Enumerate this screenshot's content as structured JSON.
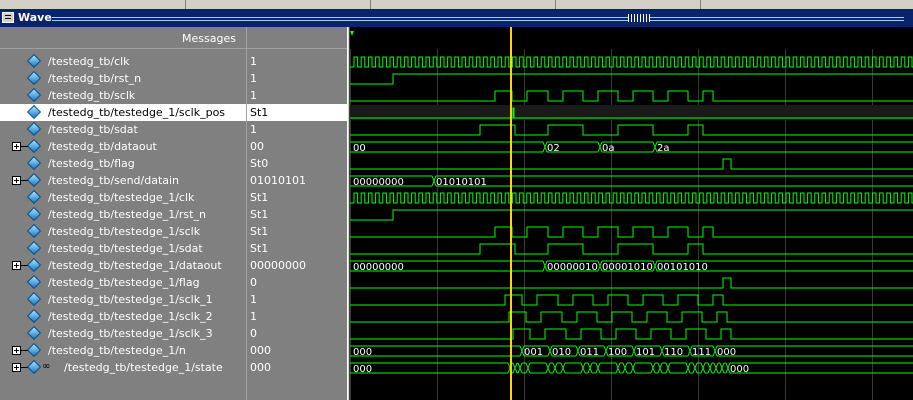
{
  "window": {
    "title": "Wave"
  },
  "columns": {
    "messages": "Messages"
  },
  "colors": {
    "wave": "#00ff00",
    "cursor": "#ffd700",
    "grid": "#3a3a3a",
    "background": "#000000"
  },
  "signals": [
    {
      "name": "/testedg_tb/clk",
      "value": "1",
      "type": "bit",
      "expandable": false
    },
    {
      "name": "/testedg_tb/rst_n",
      "value": "1",
      "type": "bit",
      "expandable": false
    },
    {
      "name": "/testedg_tb/sclk",
      "value": "1",
      "type": "bit",
      "expandable": false
    },
    {
      "name": "/testedg_tb/testedge_1/sclk_pos",
      "value": "St1",
      "type": "bit",
      "expandable": false,
      "selected": true
    },
    {
      "name": "/testedg_tb/sdat",
      "value": "1",
      "type": "bit",
      "expandable": false
    },
    {
      "name": "/testedg_tb/dataout",
      "value": "00",
      "type": "bus",
      "expandable": true
    },
    {
      "name": "/testedg_tb/flag",
      "value": "St0",
      "type": "bit",
      "expandable": false
    },
    {
      "name": "/testedg_tb/send/datain",
      "value": "01010101",
      "type": "bus",
      "expandable": true
    },
    {
      "name": "/testedg_tb/testedge_1/clk",
      "value": "St1",
      "type": "bit",
      "expandable": false
    },
    {
      "name": "/testedg_tb/testedge_1/rst_n",
      "value": "St1",
      "type": "bit",
      "expandable": false
    },
    {
      "name": "/testedg_tb/testedge_1/sclk",
      "value": "St1",
      "type": "bit",
      "expandable": false
    },
    {
      "name": "/testedg_tb/testedge_1/sdat",
      "value": "St1",
      "type": "bit",
      "expandable": false
    },
    {
      "name": "/testedg_tb/testedge_1/dataout",
      "value": "00000000",
      "type": "bus",
      "expandable": true
    },
    {
      "name": "/testedg_tb/testedge_1/flag",
      "value": "0",
      "type": "bit",
      "expandable": false
    },
    {
      "name": "/testedg_tb/testedge_1/sclk_1",
      "value": "1",
      "type": "bit",
      "expandable": false
    },
    {
      "name": "/testedg_tb/testedge_1/sclk_2",
      "value": "1",
      "type": "bit",
      "expandable": false
    },
    {
      "name": "/testedg_tb/testedge_1/sclk_3",
      "value": "0",
      "type": "bit",
      "expandable": false
    },
    {
      "name": "/testedg_tb/testedge_1/n",
      "value": "000",
      "type": "bus",
      "expandable": true
    },
    {
      "name": "/testedg_tb/testedge_1/state",
      "value": "000",
      "type": "state",
      "expandable": true
    }
  ],
  "bus_labels": {
    "dataout": [
      "00",
      "02",
      "0a",
      "2a"
    ],
    "send_datain": [
      "00000000",
      "01010101"
    ],
    "inner_dataout": [
      "00000000",
      "00000010",
      "00001010",
      "00101010"
    ],
    "n": [
      "000",
      "001",
      "010",
      "011",
      "100",
      "101",
      "110",
      "111",
      "000"
    ],
    "state": [
      "000",
      "000"
    ]
  }
}
